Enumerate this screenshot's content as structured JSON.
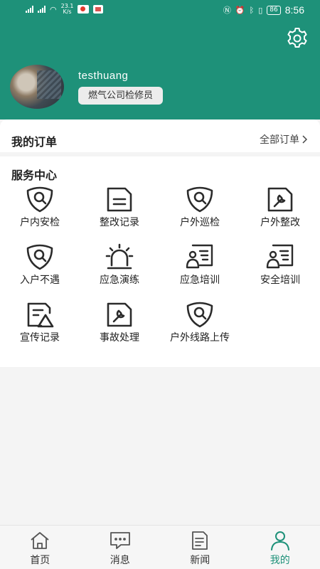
{
  "statusbar": {
    "network_speed": "23.1",
    "network_unit": "K/s",
    "battery": "86",
    "time": "8:56"
  },
  "profile": {
    "username": "testhuang",
    "role": "燃气公司检修员"
  },
  "orders": {
    "title": "我的订单",
    "all_label": "全部订单"
  },
  "services": {
    "title": "服务中心",
    "items": [
      {
        "label": "户内安检",
        "icon": "shield-search-icon"
      },
      {
        "label": "整改记录",
        "icon": "document-icon"
      },
      {
        "label": "户外巡检",
        "icon": "shield-search-icon"
      },
      {
        "label": "户外整改",
        "icon": "document-wrench-icon"
      },
      {
        "label": "入户不遇",
        "icon": "shield-search-icon"
      },
      {
        "label": "应急演练",
        "icon": "alarm-icon"
      },
      {
        "label": "应急培训",
        "icon": "person-board-icon"
      },
      {
        "label": "安全培训",
        "icon": "person-board-icon"
      },
      {
        "label": "宣传记录",
        "icon": "document-triangle-icon"
      },
      {
        "label": "事故处理",
        "icon": "document-wrench-icon"
      },
      {
        "label": "户外线路上传",
        "icon": "shield-search-icon"
      }
    ]
  },
  "nav": {
    "items": [
      {
        "label": "首页",
        "icon": "home-icon"
      },
      {
        "label": "消息",
        "icon": "message-icon"
      },
      {
        "label": "新闻",
        "icon": "news-icon"
      },
      {
        "label": "我的",
        "icon": "user-icon",
        "active": true
      }
    ]
  },
  "colors": {
    "primary": "#1e9179",
    "icon_dark": "#2b2b2b"
  }
}
